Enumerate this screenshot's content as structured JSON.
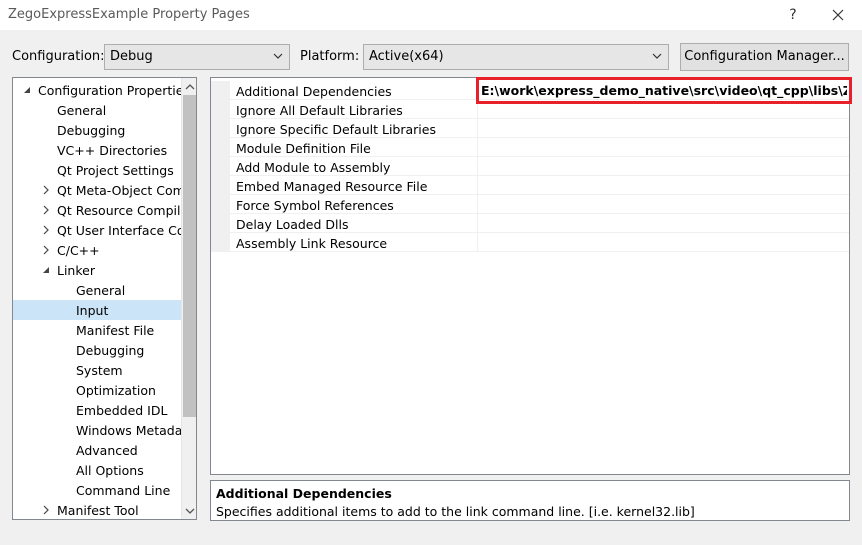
{
  "window": {
    "title": "ZegoExpressExample Property Pages",
    "help_label": "?",
    "close_label": "✕"
  },
  "toolbar": {
    "configuration_label": "Configuration:",
    "configuration_value": "Debug",
    "platform_label": "Platform:",
    "platform_value": "Active(x64)",
    "config_manager_label": "Configuration Manager..."
  },
  "tree": {
    "items": [
      {
        "label": "Configuration Properties",
        "expanded": true
      },
      {
        "label": "General"
      },
      {
        "label": "Debugging"
      },
      {
        "label": "VC++ Directories"
      },
      {
        "label": "Qt Project Settings"
      },
      {
        "label": "Qt Meta-Object Com",
        "expanded": false
      },
      {
        "label": "Qt Resource Compile",
        "expanded": false
      },
      {
        "label": "Qt User Interface Co",
        "expanded": false
      },
      {
        "label": "C/C++",
        "expanded": false
      },
      {
        "label": "Linker",
        "expanded": true
      },
      {
        "label": "General"
      },
      {
        "label": "Input",
        "selected": true
      },
      {
        "label": "Manifest File"
      },
      {
        "label": "Debugging"
      },
      {
        "label": "System"
      },
      {
        "label": "Optimization"
      },
      {
        "label": "Embedded IDL"
      },
      {
        "label": "Windows Metada"
      },
      {
        "label": "Advanced"
      },
      {
        "label": "All Options"
      },
      {
        "label": "Command Line"
      },
      {
        "label": "Manifest Tool",
        "expanded": false
      }
    ]
  },
  "properties": [
    {
      "name": "Additional Dependencies",
      "value": "E:\\work\\express_demo_native\\src\\video\\qt_cpp\\libs\\ZegoEx"
    },
    {
      "name": "Ignore All Default Libraries",
      "value": ""
    },
    {
      "name": "Ignore Specific Default Libraries",
      "value": ""
    },
    {
      "name": "Module Definition File",
      "value": ""
    },
    {
      "name": "Add Module to Assembly",
      "value": ""
    },
    {
      "name": "Embed Managed Resource File",
      "value": ""
    },
    {
      "name": "Force Symbol References",
      "value": ""
    },
    {
      "name": "Delay Loaded Dlls",
      "value": ""
    },
    {
      "name": "Assembly Link Resource",
      "value": ""
    }
  ],
  "description": {
    "title": "Additional Dependencies",
    "text": "Specifies additional items to add to the link command line. [i.e. kernel32.lib]"
  },
  "colors": {
    "highlight": "#e8202a",
    "selection": "#cce4f7"
  }
}
